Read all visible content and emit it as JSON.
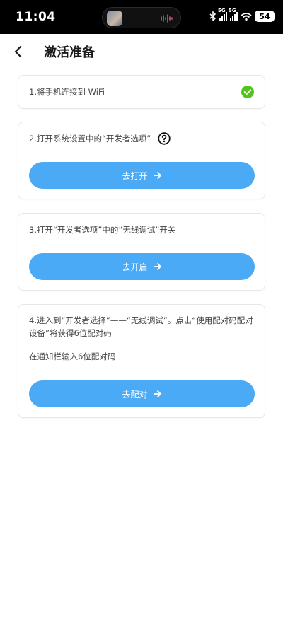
{
  "status": {
    "time": "11:04",
    "battery": "54",
    "net1": "5G",
    "net2": "5G"
  },
  "header": {
    "title": "激活准备"
  },
  "steps": [
    {
      "text": "1.将手机连接到 WiFi",
      "done": true
    },
    {
      "text": "2.打开系统设置中的“开发者选项”",
      "button": "去打开"
    },
    {
      "text": "3.打开“开发者选项”中的“无线调试”开关",
      "button": "去开启"
    },
    {
      "text": "4.进入到“开发者选择”——“无线调试”。点击“使用配对码配对设备”将获得6位配对码",
      "subtext": "在通知栏输入6位配对码",
      "button": "去配对"
    }
  ],
  "colors": {
    "accent": "#4aaaf6",
    "success": "#52c41a",
    "status_bar": "#000000"
  },
  "icons": {
    "back": "chevron-left-icon",
    "help": "question-circle-icon",
    "done": "check-circle-icon",
    "arrow": "arrow-right-icon"
  }
}
